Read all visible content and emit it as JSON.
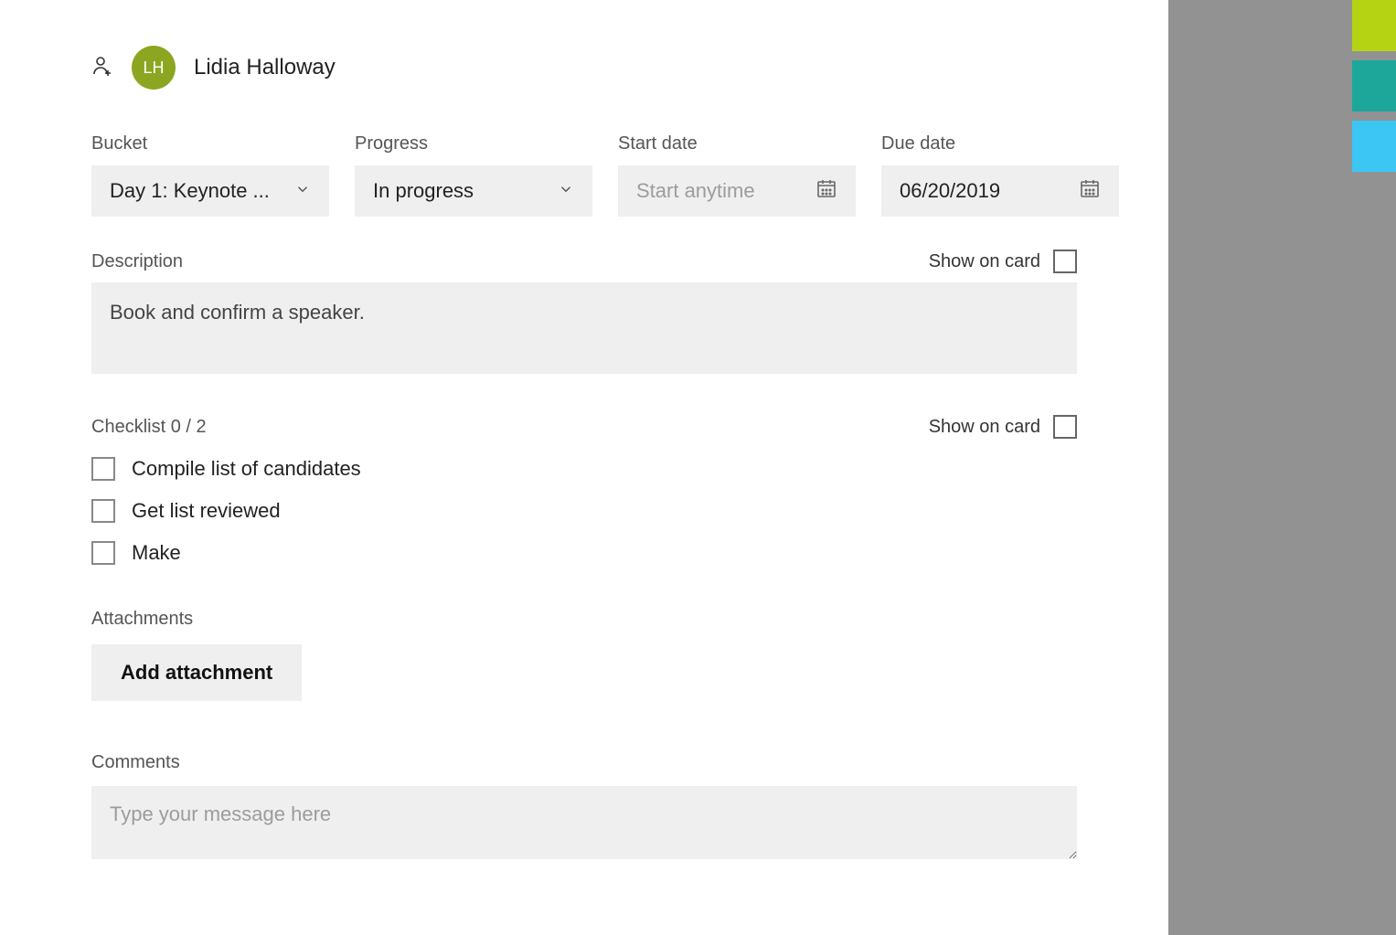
{
  "assignee": {
    "initials": "LH",
    "name": "Lidia Halloway"
  },
  "fields": {
    "bucket_label": "Bucket",
    "bucket_value": "Day 1: Keynote ...",
    "progress_label": "Progress",
    "progress_value": "In progress",
    "start_date_label": "Start date",
    "start_date_value": "",
    "start_date_placeholder": "Start anytime",
    "due_date_label": "Due date",
    "due_date_value": "06/20/2019"
  },
  "description": {
    "label": "Description",
    "text": "Book and confirm a speaker.",
    "show_on_card_label": "Show on card"
  },
  "checklist": {
    "label": "Checklist 0 / 2",
    "show_on_card_label": "Show on card",
    "items": [
      {
        "text": "Compile list of candidates"
      },
      {
        "text": "Get list reviewed"
      },
      {
        "text": "Make"
      }
    ]
  },
  "attachments": {
    "label": "Attachments",
    "button": "Add attachment"
  },
  "comments": {
    "label": "Comments",
    "placeholder": "Type your message here"
  },
  "colors": {
    "tab1": "#B5D312",
    "tab2": "#1CA79A",
    "tab3": "#3CC6F4",
    "field_bg": "#EFEFEF",
    "avatar_bg": "#8CA621"
  }
}
